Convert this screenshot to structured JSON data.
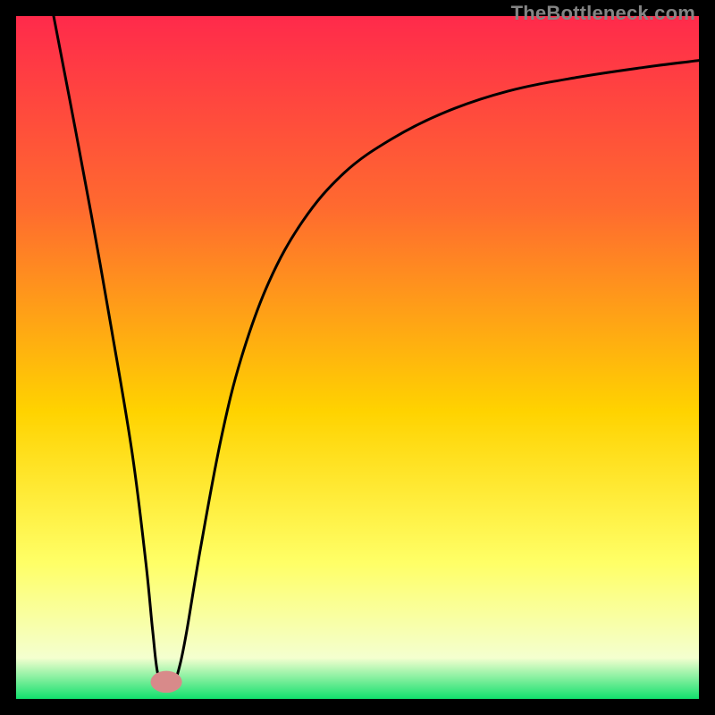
{
  "watermark": "TheBottleneck.com",
  "chart_data": {
    "type": "line",
    "title": "",
    "xlabel": "",
    "ylabel": "",
    "xlim": [
      0,
      100
    ],
    "ylim": [
      0,
      100
    ],
    "gradient": {
      "top": "#ff2a4b",
      "mid_upper": "#ff6a2f",
      "mid": "#ffd300",
      "mid_lower": "#ffff66",
      "low": "#f4ffcf",
      "bottom": "#12e06d"
    },
    "marker": {
      "x": 22,
      "y": 2.5,
      "color": "#d88a8a",
      "rx": 2.3,
      "ry": 1.6
    },
    "series": [
      {
        "name": "curve",
        "points": [
          {
            "x": 5.5,
            "y": 100.0
          },
          {
            "x": 8.0,
            "y": 87.0
          },
          {
            "x": 11.0,
            "y": 71.0
          },
          {
            "x": 14.0,
            "y": 54.0
          },
          {
            "x": 17.0,
            "y": 36.0
          },
          {
            "x": 19.0,
            "y": 20.0
          },
          {
            "x": 20.0,
            "y": 10.0
          },
          {
            "x": 20.8,
            "y": 3.5
          },
          {
            "x": 22.0,
            "y": 2.5
          },
          {
            "x": 23.2,
            "y": 2.8
          },
          {
            "x": 24.0,
            "y": 5.0
          },
          {
            "x": 25.0,
            "y": 10.0
          },
          {
            "x": 27.0,
            "y": 22.0
          },
          {
            "x": 30.0,
            "y": 38.0
          },
          {
            "x": 33.0,
            "y": 50.0
          },
          {
            "x": 37.0,
            "y": 61.0
          },
          {
            "x": 42.0,
            "y": 70.0
          },
          {
            "x": 48.0,
            "y": 77.0
          },
          {
            "x": 55.0,
            "y": 82.0
          },
          {
            "x": 63.0,
            "y": 86.0
          },
          {
            "x": 72.0,
            "y": 89.0
          },
          {
            "x": 82.0,
            "y": 91.0
          },
          {
            "x": 92.0,
            "y": 92.5
          },
          {
            "x": 100.0,
            "y": 93.5
          }
        ]
      }
    ]
  }
}
